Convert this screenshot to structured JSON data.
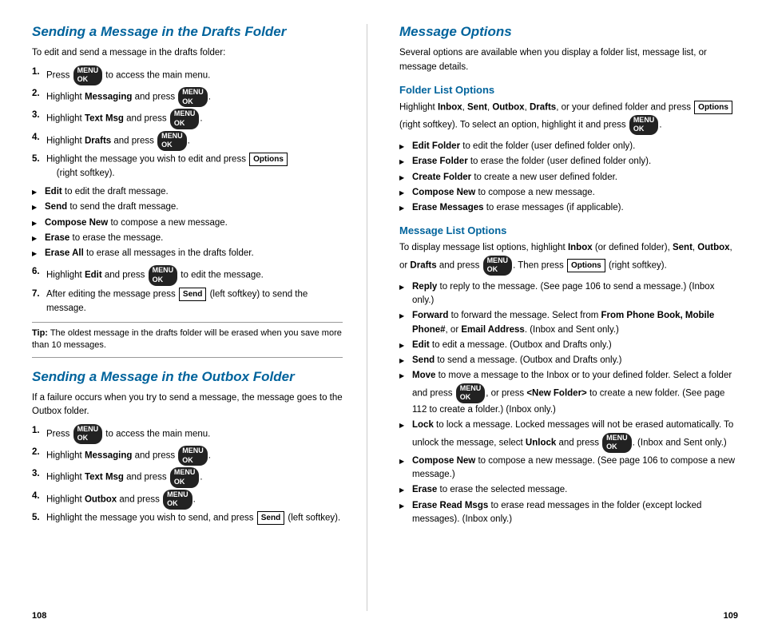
{
  "left": {
    "section1_title": "Sending a Message in the Drafts Folder",
    "section1_intro": "To edit and send a message in the drafts folder:",
    "section1_steps": [
      {
        "num": "1.",
        "text_before": "Press ",
        "menu": true,
        "text_after": " to access the main menu."
      },
      {
        "num": "2.",
        "text_before": "Highlight ",
        "bold": "Messaging",
        "text_after": " and press ",
        "menu": true,
        "end": "."
      },
      {
        "num": "3.",
        "text_before": "Highlight ",
        "bold": "Text Msg",
        "text_after": " and press ",
        "menu": true,
        "end": "."
      },
      {
        "num": "4.",
        "text_before": "Highlight ",
        "bold": "Drafts",
        "text_after": " and press ",
        "menu": true,
        "end": "."
      },
      {
        "num": "5.",
        "text_before": "Highlight the message you wish to edit and press ",
        "options": "Options",
        "text_after": "\n(right softkey)."
      },
      {
        "num": "6.",
        "text_before": "Highlight ",
        "bold": "Edit",
        "text_after": " and press ",
        "menu": true,
        "text_after2": " to edit the message."
      },
      {
        "num": "7.",
        "text_before": "After editing the message press ",
        "send": "Send",
        "text_after": " (left softkey) to send the message."
      }
    ],
    "bullets1": [
      {
        "bold": "Edit",
        "text": " to edit the draft message."
      },
      {
        "bold": "Send",
        "text": " to send the draft message."
      },
      {
        "bold": "Compose New",
        "text": " to compose a new message."
      },
      {
        "bold": "Erase",
        "text": " to erase the message."
      },
      {
        "bold": "Erase All",
        "text": " to erase all messages in the drafts folder."
      }
    ],
    "tip_label": "Tip:",
    "tip_text": " The oldest message in the drafts folder will be erased when you save more than 10 messages.",
    "section2_title": "Sending a Message in the Outbox Folder",
    "section2_intro": "If a failure occurs when you try to send a message, the message goes to the Outbox folder.",
    "section2_steps": [
      {
        "num": "1.",
        "text_before": "Press ",
        "menu": true,
        "text_after": " to access the main menu."
      },
      {
        "num": "2.",
        "text_before": "Highlight ",
        "bold": "Messaging",
        "text_after": " and press ",
        "menu": true,
        "end": "."
      },
      {
        "num": "3.",
        "text_before": "Highlight ",
        "bold": "Text Msg",
        "text_after": " and press ",
        "menu": true,
        "end": "."
      },
      {
        "num": "4.",
        "text_before": "Highlight ",
        "bold": "Outbox",
        "text_after": " and press ",
        "menu": true,
        "end": "."
      },
      {
        "num": "5.",
        "text_before": "Highlight the message you wish to send, and press ",
        "send": "Send",
        "text_after": " (left softkey)."
      }
    ],
    "page_num": "108"
  },
  "right": {
    "section_title": "Message Options",
    "section_intro": "Several options are available when you display a folder list, message list, or message details.",
    "folder_title": "Folder List Options",
    "folder_intro_before": "Highlight ",
    "folder_bold_items": "Inbox, Sent, Outbox, Drafts",
    "folder_intro_after": ", or your defined folder and press ",
    "folder_options": "Options",
    "folder_intro_cont": " (right softkey). To select an option, highlight it and press ",
    "folder_bullets": [
      {
        "bold": "Edit Folder",
        "text": " to edit the folder (user defined folder only)."
      },
      {
        "bold": "Erase Folder",
        "text": " to erase the folder (user defined folder only)."
      },
      {
        "bold": "Create Folder",
        "text": " to create a new user defined folder."
      },
      {
        "bold": "Compose New",
        "text": " to compose a new message."
      },
      {
        "bold": "Erase Messages",
        "text": " to erase messages (if applicable)."
      }
    ],
    "msglist_title": "Message List Options",
    "msglist_intro": "To display message list options, highlight ",
    "msglist_bold1": "Inbox",
    "msglist_intro2": " (or defined folder), ",
    "msglist_bold2": "Sent",
    "msglist_intro3": ", ",
    "msglist_bold3": "Outbox",
    "msglist_intro4": ", or ",
    "msglist_bold4": "Drafts",
    "msglist_intro5": " and press ",
    "msglist_intro6": ". Then press ",
    "msglist_options": "Options",
    "msglist_intro7": " (right softkey).",
    "msglist_bullets": [
      {
        "bold": "Reply",
        "text": " to reply to the message. (See page 106 to send a message.) (Inbox only.)"
      },
      {
        "bold": "Forward",
        "text": " to forward the message. Select from ",
        "bold2": "From Phone Book, Mobile Phone#",
        "text2": ", or ",
        "bold3": "Email Address",
        "text3": ". (Inbox and Sent only.)"
      },
      {
        "bold": "Edit",
        "text": " to edit a message. (Outbox and Drafts only.)"
      },
      {
        "bold": "Send",
        "text": " to send a message. (Outbox and Drafts only.)"
      },
      {
        "bold": "Move",
        "text": " to move a message to the Inbox or to your defined folder. Select a folder and press ",
        "menu": true,
        "text2": ", or press ",
        "bold2": "<New Folder>",
        "text3": " to create a new folder. (See page 112 to create a folder.) (Inbox only.)"
      },
      {
        "bold": "Lock",
        "text": " to lock a message. Locked messages will not be erased automatically. To unlock the message, select ",
        "bold2": "Unlock",
        "text2": " and press ",
        "menu": true,
        "text3": ". (Inbox and Sent only.)"
      },
      {
        "bold": "Compose New",
        "text": " to compose a new message. (See page 106 to compose a new message.)"
      },
      {
        "bold": "Erase",
        "text": " to erase the selected message."
      },
      {
        "bold": "Erase Read Msgs",
        "text": " to erase read messages in the folder (except locked messages). (Inbox only.)"
      }
    ],
    "page_num": "109"
  }
}
